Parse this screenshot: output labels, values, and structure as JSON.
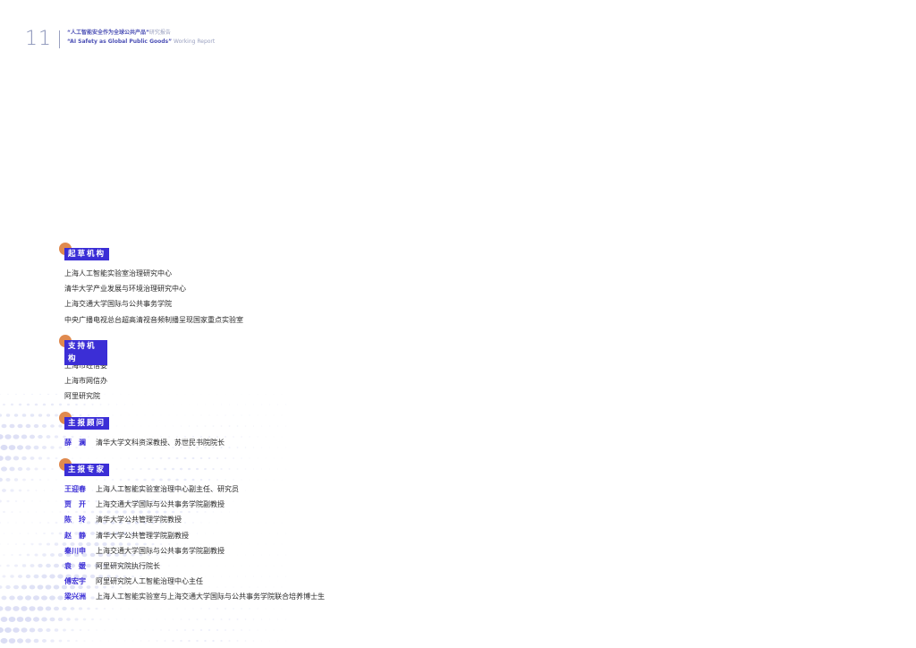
{
  "header": {
    "page_number": "11",
    "title_cn": "“人工智能安全作为全球公共产品”",
    "title_cn_suffix": "研究报告",
    "title_en": "“AI Safety as Global Public Goods”",
    "title_en_suffix": "Working Report"
  },
  "sections": [
    {
      "label": "起草机构",
      "items": [
        "上海人工智能实验室治理研究中心",
        "清华大学产业发展与环境治理研究中心",
        "上海交通大学国际与公共事务学院",
        "中央广播电视总台超高清视音频制播呈现国家重点实验室"
      ]
    },
    {
      "label": "支持机构",
      "items": [
        "上海市经信委",
        "上海市网信办",
        "阿里研究院"
      ]
    },
    {
      "label": "主报顾问",
      "people": [
        {
          "name": "薛　澜",
          "role": "清华大学文科资深教授、苏世民书院院长"
        }
      ]
    },
    {
      "label": "主报专家",
      "people": [
        {
          "name": "王迎春",
          "role": "上海人工智能实验室治理中心副主任、研究员"
        },
        {
          "name": "贾　开",
          "role": "上海交通大学国际与公共事务学院副教授"
        },
        {
          "name": "陈　玲",
          "role": "清华大学公共管理学院教授"
        },
        {
          "name": "赵　静",
          "role": "清华大学公共管理学院副教授"
        },
        {
          "name": "秦川申",
          "role": "上海交通大学国际与公共事务学院副教授"
        },
        {
          "name": "袁　媛",
          "role": "阿里研究院执行院长"
        },
        {
          "name": "傅宏宇",
          "role": "阿里研究院人工智能治理中心主任"
        },
        {
          "name": "梁兴洲",
          "role": "上海人工智能实验室与上海交通大学国际与公共事务学院联合培养博士生"
        }
      ]
    }
  ],
  "colors": {
    "accent": "#3b2ed6",
    "dot": "#e08a4f",
    "header": "#4b4fb5"
  }
}
